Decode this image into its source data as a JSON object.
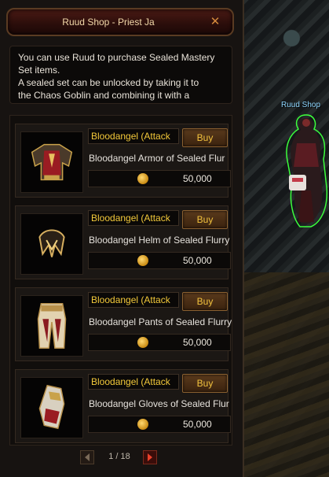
{
  "window": {
    "title": "Ruud Shop - Priest Ja"
  },
  "description": {
    "lines": [
      "You can use Ruud to purchase Sealed Mastery",
      "Set items.",
      "A sealed set can be unlocked by taking it to",
      "the Chaos Goblin and combining it with a"
    ]
  },
  "items": [
    {
      "set_label": "Bloodangel (Attack",
      "buy_label": "Buy",
      "name": "Bloodangel Armor of Sealed Flur",
      "price": "50,000",
      "icon": "armor-icon"
    },
    {
      "set_label": "Bloodangel (Attack",
      "buy_label": "Buy",
      "name": "Bloodangel Helm of Sealed Flurry",
      "price": "50,000",
      "icon": "helm-icon"
    },
    {
      "set_label": "Bloodangel (Attack",
      "buy_label": "Buy",
      "name": "Bloodangel Pants of Sealed Flurry",
      "price": "50,000",
      "icon": "pants-icon"
    },
    {
      "set_label": "Bloodangel (Attack",
      "buy_label": "Buy",
      "name": "Bloodangel Gloves of Sealed Flur",
      "price": "50,000",
      "icon": "gloves-icon"
    }
  ],
  "pagination": {
    "label": "1 / 18"
  },
  "npc": {
    "label": "Ruud Shop"
  },
  "colors": {
    "accent_gold": "#f3c93a",
    "title_text": "#f1d7a8",
    "npc_label": "#8fd7ff"
  }
}
